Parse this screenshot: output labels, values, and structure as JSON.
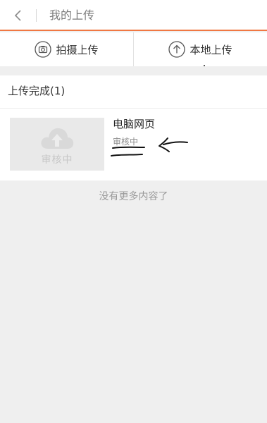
{
  "header": {
    "title": "我的上传"
  },
  "toolbar": {
    "capture_label": "拍摄上传",
    "local_label": "本地上传"
  },
  "section": {
    "title": "上传完成(1)"
  },
  "items": [
    {
      "name": "电脑网页",
      "status": "审核中",
      "thumb_text": "审核中"
    }
  ],
  "footer": {
    "text": "没有更多内容了"
  },
  "colors": {
    "accent": "#f07843",
    "background": "#efefef"
  },
  "icons": {
    "back": "chevron-left-icon",
    "camera": "camera-icon",
    "upload": "upload-arrow-icon",
    "cloud": "cloud-upload-icon"
  }
}
